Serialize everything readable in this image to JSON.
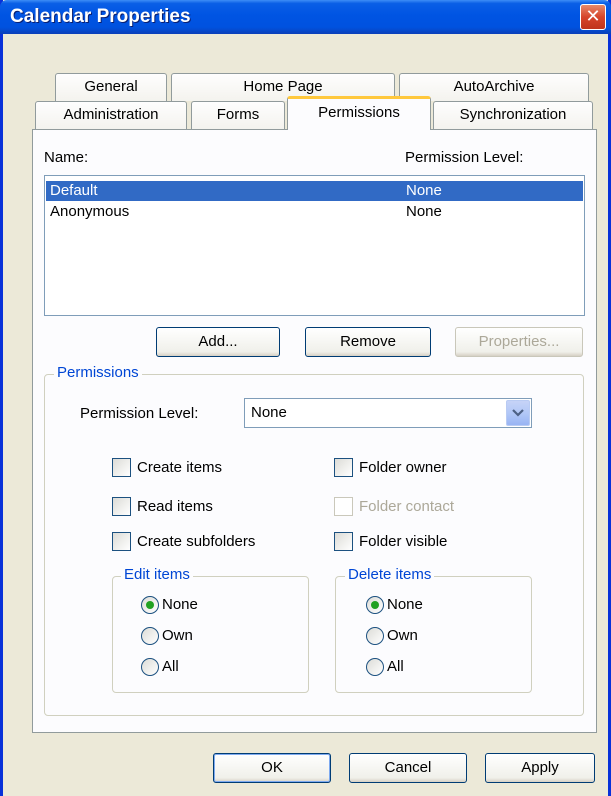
{
  "window": {
    "title": "Calendar Properties",
    "close_glyph": "✕"
  },
  "tabs": {
    "row1": [
      "General",
      "Home Page",
      "AutoArchive"
    ],
    "row2": [
      "Administration",
      "Forms",
      "Permissions",
      "Synchronization"
    ],
    "active": "Permissions"
  },
  "list": {
    "name_header": "Name:",
    "level_header": "Permission Level:",
    "rows": [
      {
        "name": "Default",
        "level": "None",
        "selected": true
      },
      {
        "name": "Anonymous",
        "level": "None",
        "selected": false
      }
    ]
  },
  "list_buttons": {
    "add": "Add...",
    "remove": "Remove",
    "properties": "Properties..."
  },
  "permissions": {
    "group_label": "Permissions",
    "level_label": "Permission Level:",
    "level_value": "None",
    "checkboxes": {
      "create_items": "Create items",
      "read_items": "Read items",
      "create_subfolders": "Create subfolders",
      "folder_owner": "Folder owner",
      "folder_contact": "Folder contact",
      "folder_visible": "Folder visible"
    },
    "edit_items": {
      "label": "Edit items",
      "options": [
        "None",
        "Own",
        "All"
      ],
      "selected": "None"
    },
    "delete_items": {
      "label": "Delete items",
      "options": [
        "None",
        "Own",
        "All"
      ],
      "selected": "None"
    }
  },
  "footer": {
    "ok": "OK",
    "cancel": "Cancel",
    "apply": "Apply"
  },
  "colors": {
    "title_bar": "#0054e3",
    "selection": "#316ac5",
    "group_label": "#0046d5",
    "close_button": "#d6452b",
    "radio_dot": "#21a121"
  }
}
